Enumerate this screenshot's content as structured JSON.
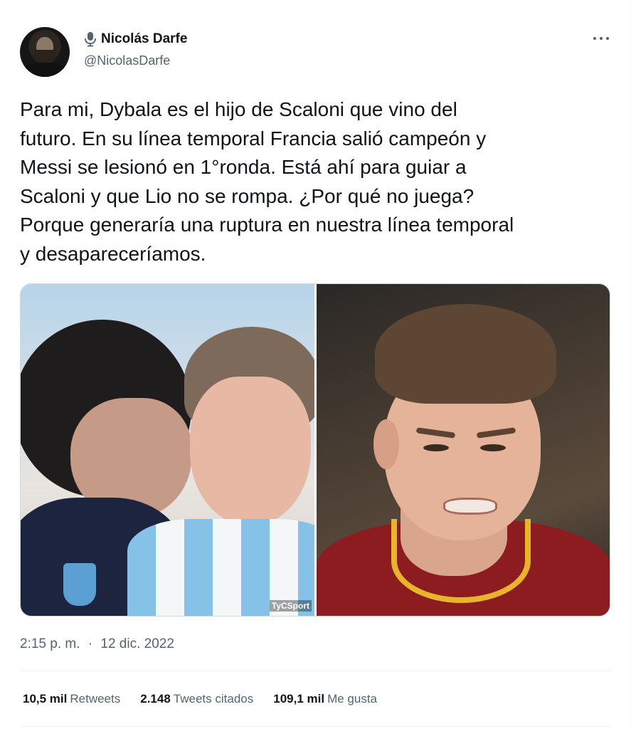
{
  "author": {
    "display_name": "Nicolás Darfe",
    "handle": "@NicolasDarfe",
    "badge_icon": "microphone-icon"
  },
  "tweet": {
    "text": "Para mi, Dybala es el hijo de Scaloni que vino del\nfuturo. En su línea temporal Francia salió campeón y\nMessi se lesionó en 1°ronda. Está ahí para guiar a\nScaloni y que Lio no se rompa. ¿Por qué no juega?\nPorque generaría una ruptura en nuestra línea temporal\ny desapareceríamos.",
    "time": "2:15 p. m.",
    "separator": "·",
    "date": "12 dic. 2022"
  },
  "media": {
    "left_watermark": "TyCSport"
  },
  "stats": {
    "retweets_count": "10,5 mil",
    "retweets_label": "Retweets",
    "quotes_count": "2.148",
    "quotes_label": "Tweets citados",
    "likes_count": "109,1 mil",
    "likes_label": "Me gusta"
  },
  "colors": {
    "text": "#0f1419",
    "secondary": "#536471",
    "border": "#eff3f4"
  }
}
